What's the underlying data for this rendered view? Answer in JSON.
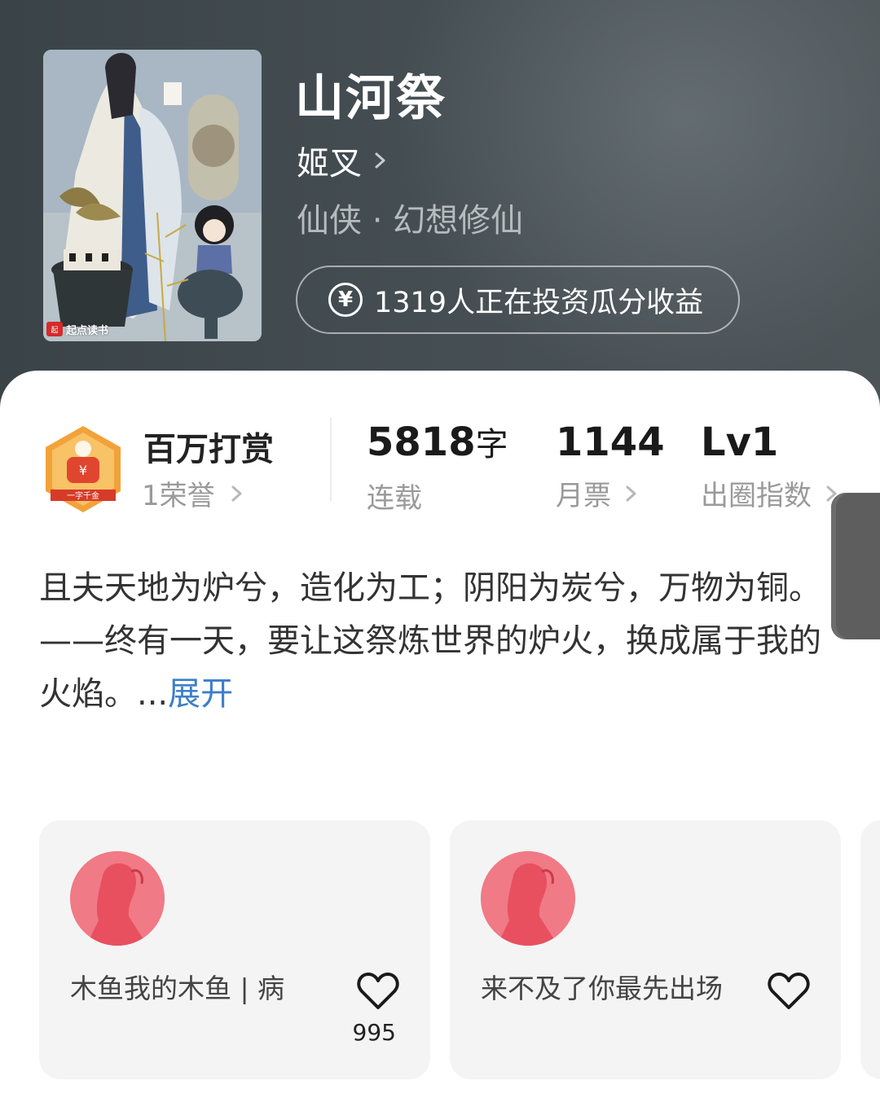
{
  "book": {
    "title": "山河祭",
    "author": "姬叉",
    "genre": "仙侠 · 幻想修仙",
    "invest_text": "1319人正在投资瓜分收益",
    "cover_publisher": "起点读书"
  },
  "award": {
    "title": "百万打赏",
    "subtitle": "1荣誉",
    "badge_text": "一字千金"
  },
  "stats": {
    "words_value": "5818",
    "words_unit": "字",
    "words_label": "连载",
    "monthly_votes": "1144",
    "monthly_label": "月票",
    "level": "Lv1",
    "level_label": "出圈指数"
  },
  "synopsis": {
    "line1": "且夫天地为炉兮，造化为工；阴阳为炭兮，万物为铜。",
    "line2": "——终有一天，要让这祭炼世界的炉火，换成属于我的火焰。...",
    "expand": "展开"
  },
  "fans": [
    {
      "name": "木鱼我的木鱼 | 病",
      "likes": "995"
    },
    {
      "name": "来不及了你最先出场",
      "likes": ""
    }
  ],
  "colors": {
    "header_bg": "#3f484d",
    "accent_blue": "#3d7ec9",
    "avatar_pink": "#f07a86",
    "badge_orange": "#f2a23a"
  },
  "icons": {
    "author_chevron": "chevron-right-icon",
    "invest": "yen-circle-icon",
    "like": "heart-outline-icon"
  }
}
